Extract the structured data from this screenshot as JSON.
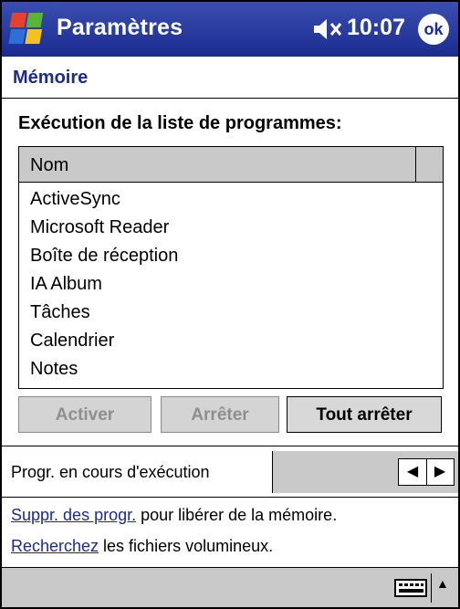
{
  "titlebar": {
    "app_title": "Paramètres",
    "time": "10:07",
    "ok_label": "ok",
    "bg_color": "#1b2b8f"
  },
  "page": {
    "title": "Mémoire",
    "section_label": "Exécution de la liste de programmes:"
  },
  "list": {
    "column_header": "Nom",
    "items": [
      "ActiveSync",
      "Microsoft Reader",
      "Boîte de réception",
      "IA Album",
      "Tâches",
      "Calendrier",
      "Notes"
    ]
  },
  "buttons": {
    "activate": "Activer",
    "stop": "Arrêter",
    "stop_all": "Tout arrêter"
  },
  "running": {
    "label": "Progr. en cours d'exécution"
  },
  "links": {
    "remove_link": "Suppr. des progr.",
    "remove_rest": " pour libérer de la mémoire.",
    "search_link": "Recherchez",
    "search_rest": " les fichiers volumineux."
  },
  "icons": {
    "start": "windows-flag-icon",
    "speaker": "speaker-muted-icon",
    "keyboard": "keyboard-icon",
    "arrow_up": "arrow-up-icon",
    "scroll_left": "arrow-left-icon",
    "scroll_right": "arrow-right-icon"
  }
}
